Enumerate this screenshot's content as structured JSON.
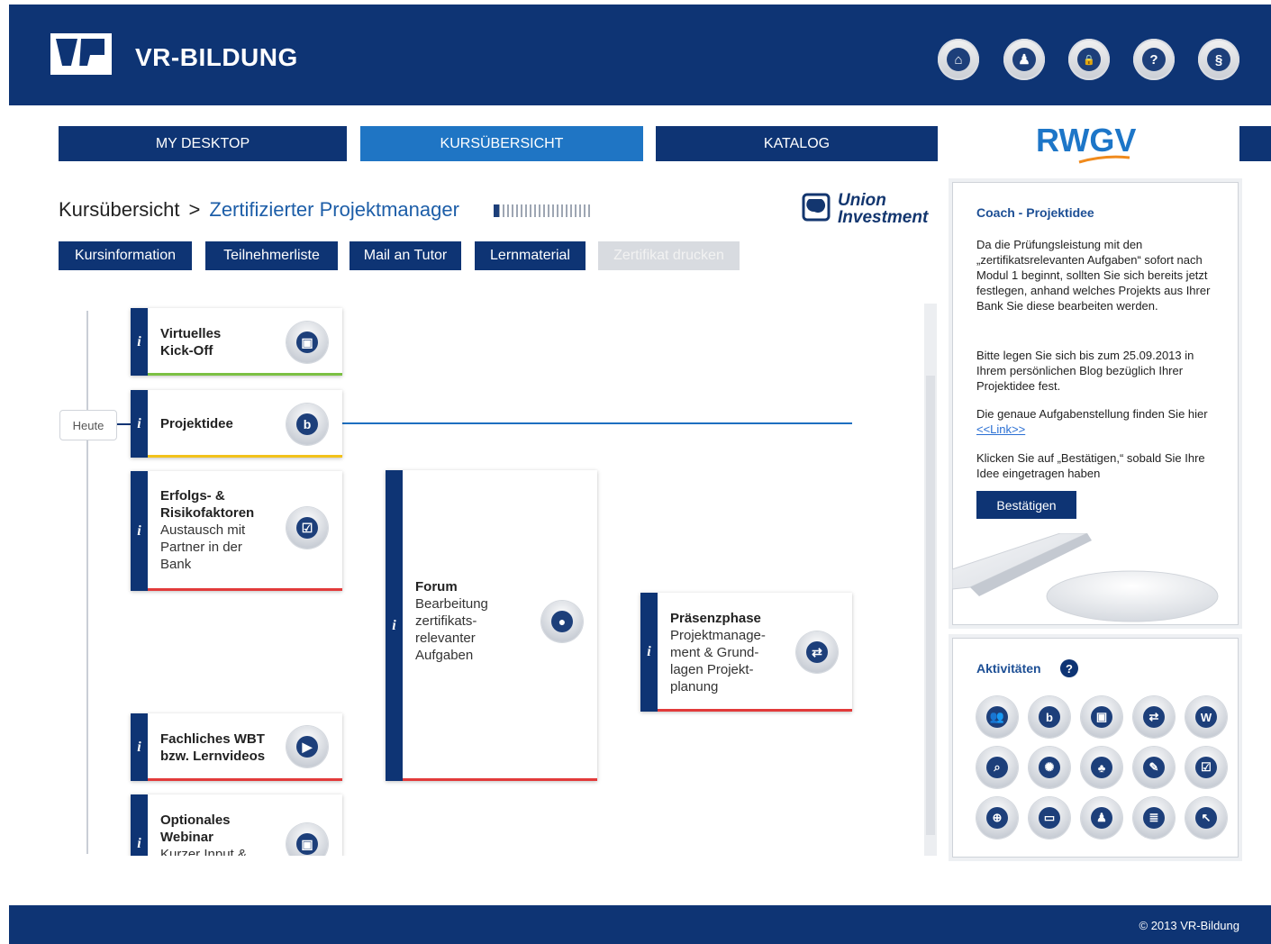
{
  "header": {
    "brand": "VR-BILDUNG",
    "icons": [
      "home-icon",
      "user-icon",
      "lock-icon",
      "help-icon",
      "paragraph-icon"
    ],
    "icon_glyphs": [
      "⌂",
      "♟",
      "🔒",
      "?",
      "§"
    ]
  },
  "nav": {
    "tabs": [
      "MY DESKTOP",
      "KURSÜBERSICHT",
      "KATALOG"
    ],
    "active": "KURSÜBERSICHT",
    "partner_logo": "RWGV"
  },
  "breadcrumb": {
    "root": "Kursübersicht",
    "separator": ">",
    "current": "Zertifizierter Projektmanager"
  },
  "sponsor": {
    "line1": "Union",
    "line2": "Investment"
  },
  "subnav": {
    "buttons": [
      "Kursinformation",
      "Teilnehmerliste",
      "Mail an Tutor",
      "Lernmaterial",
      "Zertifikat drucken"
    ],
    "disabled": "Zertifikat drucken"
  },
  "timeline": {
    "today_label": "Heute",
    "info_marker": "i",
    "cards": [
      {
        "title": "Virtuelles Kick-Off",
        "line1": "Virtuelles",
        "line2": "Kick-Off",
        "icon": "virtual-classroom-icon",
        "status_color": "#7bc043"
      },
      {
        "title": "Projektidee",
        "icon": "blog-icon",
        "status_color": "#f2c21b"
      },
      {
        "title1": "Erfolgs- &",
        "title2": "Risikofaktoren",
        "desc": [
          "Austausch mit",
          "Partner in der",
          "Bank"
        ],
        "icon": "checklist-icon",
        "status_color": "#e23a3a"
      },
      {
        "title": "Forum",
        "desc": [
          "Bearbeitung",
          "zertifikats-",
          "relevanter",
          "Aufgaben"
        ],
        "icon": "forum-icon",
        "status_color": "#e23a3a"
      },
      {
        "title": "Präsenzphase",
        "desc": [
          "Projektmanage-",
          "ment & Grund-",
          "lagen Projekt-",
          "planung"
        ],
        "icon": "presence-icon",
        "status_color": "#e23a3a"
      },
      {
        "title1": "Fachliches WBT",
        "title2": "bzw. Lernvideos",
        "icon": "play-icon",
        "status_color": "#e23a3a"
      },
      {
        "title1": "Optionales",
        "title2": "Webinar",
        "desc": [
          "Kurzer Input &"
        ],
        "icon": "webinar-icon",
        "status_color": "#e23a3a"
      }
    ]
  },
  "coach": {
    "title": "Coach - Projektidee",
    "p1": "Da die Prüfungsleistung mit den „zertifikatsrelevanten Aufgaben“ sofort nach Modul 1 beginnt, sollten Sie sich bereits jetzt festlegen, anhand welches Projekts aus Ihrer Bank Sie diese bearbeiten werden.",
    "p2": "Bitte legen Sie sich bis zum 25.09.2013 in Ihrem persönlichen Blog bezüglich Ihrer Projektidee fest.",
    "p3_text": "Die genaue Aufgabenstellung finden Sie hier",
    "p3_link": "<<Link>>",
    "p4": "Klicken Sie auf „Bestätigen,“ sobald Sie Ihre Idee eingetragen haben",
    "button": "Bestätigen"
  },
  "activities": {
    "title": "Aktivitäten",
    "help": "?",
    "icons": [
      {
        "name": "forum-icon",
        "glyph": "👥"
      },
      {
        "name": "blog-icon",
        "glyph": "b"
      },
      {
        "name": "virtual-classroom-icon",
        "glyph": "▣"
      },
      {
        "name": "presence-icon",
        "glyph": "⇄"
      },
      {
        "name": "wiki-icon",
        "glyph": "W"
      },
      {
        "name": "search-icon",
        "glyph": "⌕"
      },
      {
        "name": "idea-icon",
        "glyph": "✺"
      },
      {
        "name": "group-icon",
        "glyph": "♣"
      },
      {
        "name": "chat-icon",
        "glyph": "✎"
      },
      {
        "name": "checklist-icon",
        "glyph": "☑"
      },
      {
        "name": "globe-icon",
        "glyph": "⊕"
      },
      {
        "name": "video-icon",
        "glyph": "▭"
      },
      {
        "name": "person-icon",
        "glyph": "♟"
      },
      {
        "name": "document-icon",
        "glyph": "≣"
      },
      {
        "name": "pointer-icon",
        "glyph": "↖"
      }
    ]
  },
  "footer": {
    "copyright": "© 2013 VR-Bildung"
  },
  "colors": {
    "brand_blue": "#0e3474",
    "active_tab": "#1f75c4",
    "today_line": "#1d6fc0"
  }
}
